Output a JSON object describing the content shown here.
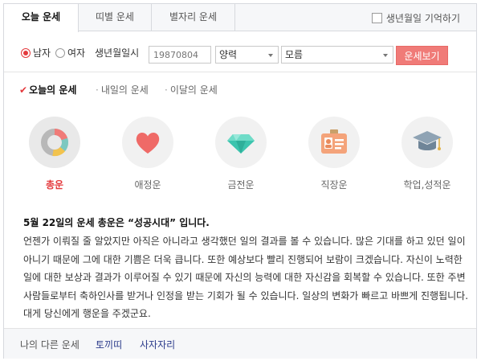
{
  "tabs": [
    "오늘 운세",
    "띠별 운세",
    "별자리 운세"
  ],
  "remember_label": "생년월일 기억하기",
  "form": {
    "gender_male": "남자",
    "gender_female": "여자",
    "birth_label": "생년월일시",
    "birth_placeholder": "19870804",
    "calendar_value": "양력",
    "time_value": "모름",
    "submit_label": "운세보기"
  },
  "subtabs": [
    "오늘의 운세",
    "내일의 운세",
    "이달의 운세"
  ],
  "categories": [
    {
      "label": "총운",
      "icon": "donut-chart-icon"
    },
    {
      "label": "애정운",
      "icon": "heart-icon"
    },
    {
      "label": "금전운",
      "icon": "diamond-icon"
    },
    {
      "label": "직장운",
      "icon": "id-card-icon"
    },
    {
      "label": "학업,성적운",
      "icon": "graduation-cap-icon"
    }
  ],
  "fortune": {
    "headline": "5월 22일의 운세 총운은 “성공시대” 입니다.",
    "body": "언젠가 이뤄질 줄 알았지만 아직은 아니라고 생각했던 일의 결과를 볼 수 있습니다. 많은 기대를 하고 있던 일이 아니기 때문에 그에 대한 기쁨은 더욱 큽니다. 또한 예상보다 빨리 진행되어 보람이 크겠습니다. 자신이 노력한 일에 대한 보상과 결과가 이루어질 수 있기 때문에 자신의 능력에 대한 자신감을 회복할 수 있습니다. 또한 주변 사람들로부터 축하인사를 받거나 인정을 받는 기회가 될 수 있습니다. 일상의 변화가 빠르고 바쁘게 진행됩니다. 대게 당신에게 행운을 주겠군요."
  },
  "footer": {
    "label": "나의 다른 운세",
    "link1": "토끼띠",
    "link2": "사자자리"
  },
  "colors": {
    "accent": "#e4393c",
    "button": "#f07b78",
    "link": "#2a3a8a"
  }
}
